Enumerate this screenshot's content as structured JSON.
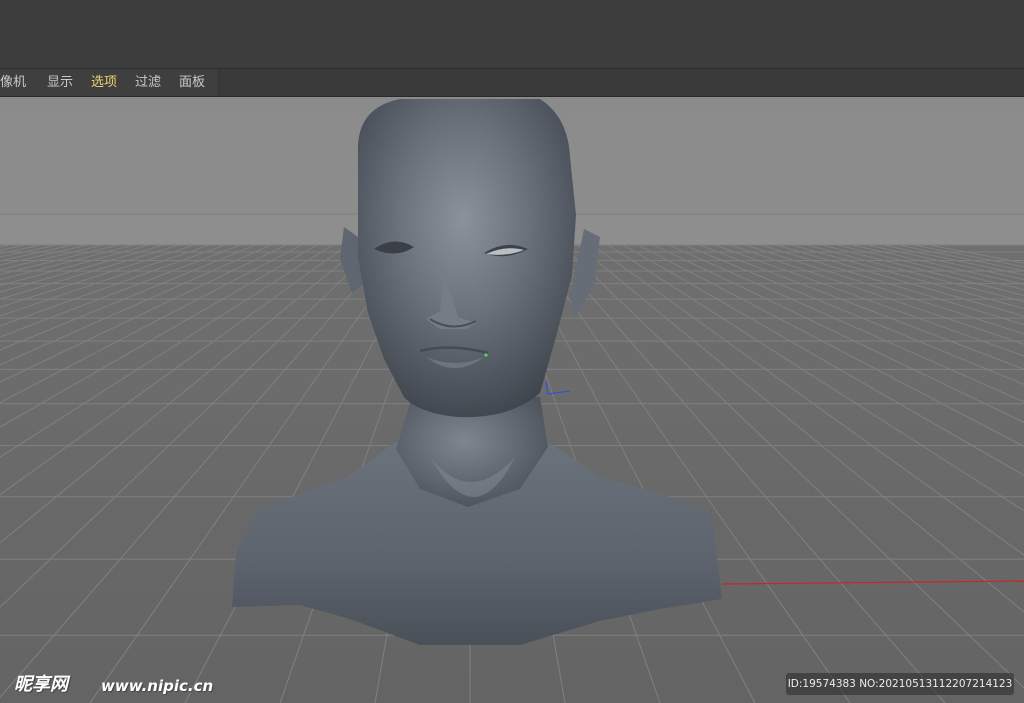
{
  "menu": {
    "items": [
      {
        "label": "摄像机",
        "active": false
      },
      {
        "label": "显示",
        "active": false
      },
      {
        "label": "选项",
        "active": true
      },
      {
        "label": "过滤",
        "active": false
      },
      {
        "label": "面板",
        "active": false
      }
    ],
    "active_color": "#e8d478"
  },
  "viewport": {
    "object": "head-bust-model",
    "grid": true,
    "x_axis_color": "#c62828",
    "axis_gizmo_color": "#3a4fd6",
    "model_color": "#5f6670"
  },
  "watermark": {
    "logo_text": "昵享网",
    "site": "www.nipic.cn",
    "id_text": "ID:19574383 NO:20210513112207214123"
  }
}
